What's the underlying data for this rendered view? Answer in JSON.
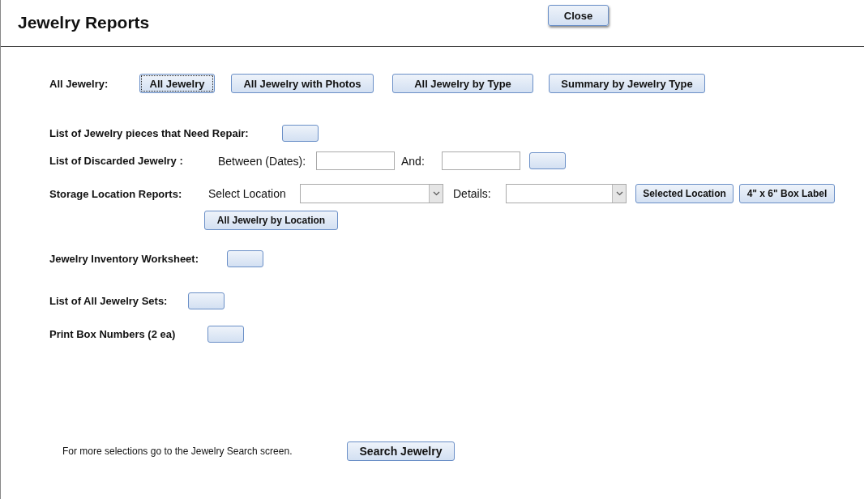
{
  "header": {
    "title": "Jewelry Reports",
    "close_button": "Close"
  },
  "all_jewelry": {
    "label": "All Jewelry:",
    "buttons": [
      {
        "label": "All Jewelry",
        "focused": true
      },
      {
        "label": "All Jewelry with Photos",
        "focused": false
      },
      {
        "label": "All Jewelry by Type",
        "focused": false
      },
      {
        "label": "Summary by Jewelry Type",
        "focused": false
      }
    ]
  },
  "repair": {
    "label": "List of Jewelry pieces that Need Repair:"
  },
  "discarded": {
    "label": "List of Discarded Jewelry :",
    "between_label": "Between (Dates):",
    "and_label": "And:"
  },
  "storage": {
    "label": "Storage Location Reports:",
    "select_label": "Select Location",
    "details_label": "Details:",
    "buttons": [
      "Selected Location",
      "4\" x 6\" Box Label"
    ],
    "location_button": "All Jewelry by Location"
  },
  "worksheet": {
    "label": "Jewelry Inventory Worksheet:"
  },
  "sets": {
    "label": "List of All Jewelry Sets:"
  },
  "box_numbers": {
    "label": "Print Box Numbers (2 ea)"
  },
  "footer": {
    "text": "For more selections go to the Jewelry Search screen.",
    "button": "Search  Jewelry"
  }
}
